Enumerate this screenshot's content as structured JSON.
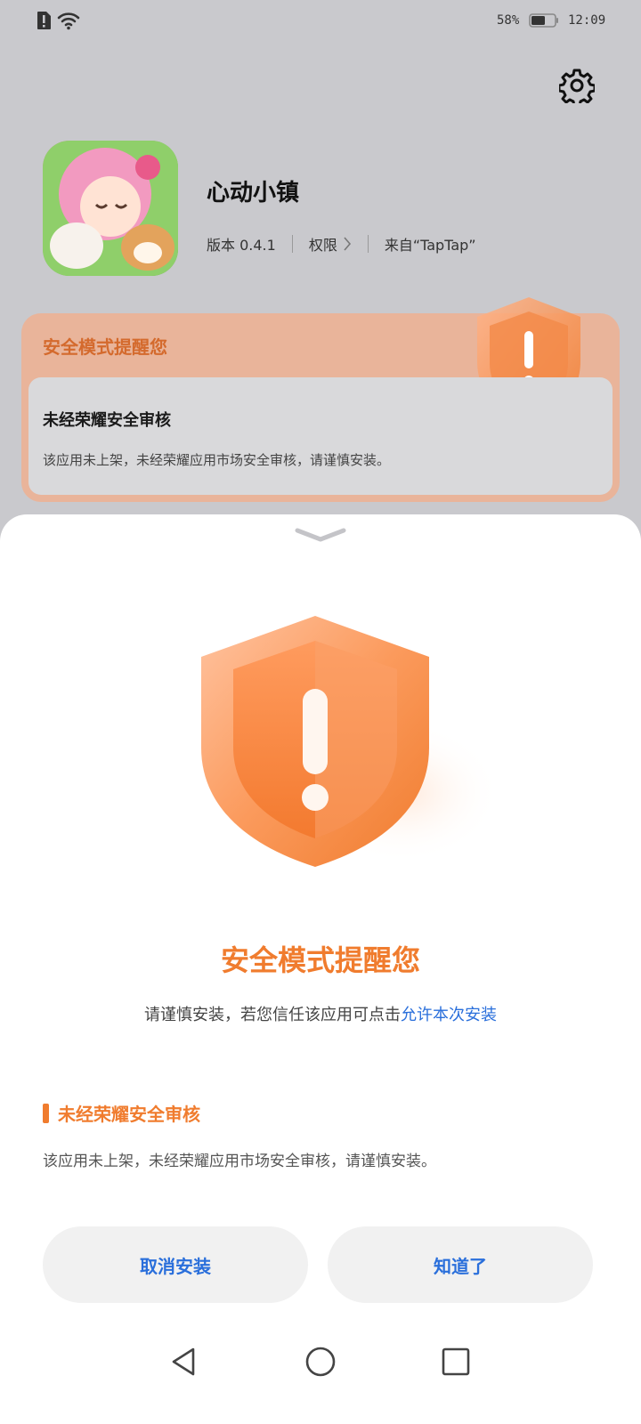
{
  "status_bar": {
    "battery": "58%",
    "time": "12:09",
    "icons": [
      "sim-alert-icon",
      "wifi-icon",
      "battery-icon"
    ]
  },
  "header": {
    "settings_icon": "gear-icon"
  },
  "app": {
    "name": "心动小镇",
    "version": "版本 0.4.1",
    "permissions_label": "权限",
    "source": "来自“TapTap”"
  },
  "warning_card": {
    "title": "安全模式提醒您",
    "inner_title": "未经荣耀安全审核",
    "inner_desc": "该应用未上架，未经荣耀应用市场安全审核，请谨慎安装。",
    "icon": "shield-alert-icon"
  },
  "sheet": {
    "handle_icon": "chevron-down-icon",
    "title": "安全模式提醒您",
    "subtitle_prefix": "请谨慎安装，若您信任该应用可点击",
    "subtitle_link": "允许本次安装",
    "reason_title": "未经荣耀安全审核",
    "reason_desc": "该应用未上架，未经荣耀应用市场安全审核，请谨慎安装。",
    "cancel_label": "取消安装",
    "ok_label": "知道了"
  },
  "nav": {
    "icons": [
      "back-icon",
      "home-icon",
      "recents-icon"
    ]
  },
  "colors": {
    "accent_orange": "#f07c2e",
    "link_blue": "#2a6fdb",
    "card_bg": "#e9b49a",
    "scrim_bg": "#c9c9cd"
  }
}
